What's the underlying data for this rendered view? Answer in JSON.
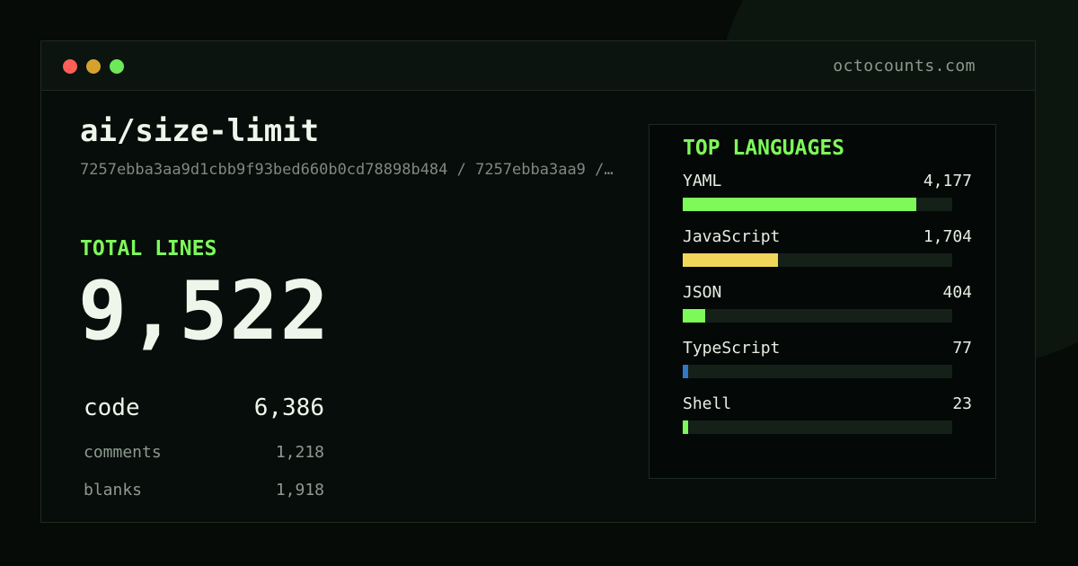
{
  "header": {
    "site": "octocounts.com"
  },
  "repo": {
    "name": "ai/size-limit",
    "hash_line": "7257ebba3aa9d1cbb9f93bed660b0cd78898b484 / 7257ebba3aa9 /…"
  },
  "totals": {
    "label": "TOTAL LINES",
    "value": "9,522",
    "rows": [
      {
        "label": "code",
        "value": "6,386"
      },
      {
        "label": "comments",
        "value": "1,218"
      },
      {
        "label": "blanks",
        "value": "1,918"
      }
    ]
  },
  "languages": {
    "title": "TOP LANGUAGES",
    "items": [
      {
        "name": "YAML",
        "count": "4,177",
        "fraction": 0.867,
        "color": "#7dfa5a"
      },
      {
        "name": "JavaScript",
        "count": "1,704",
        "fraction": 0.353,
        "color": "#f0d75a"
      },
      {
        "name": "JSON",
        "count": "404",
        "fraction": 0.084,
        "color": "#7dfa5a"
      },
      {
        "name": "TypeScript",
        "count": "77",
        "fraction": 0.02,
        "color": "#3178c6"
      },
      {
        "name": "Shell",
        "count": "23",
        "fraction": 0.02,
        "color": "#7dfa5a"
      }
    ]
  },
  "window_controls": {
    "close_color": "#ff5f56",
    "minimize_color": "#d6a22e",
    "maximize_color": "#6fe85a"
  }
}
